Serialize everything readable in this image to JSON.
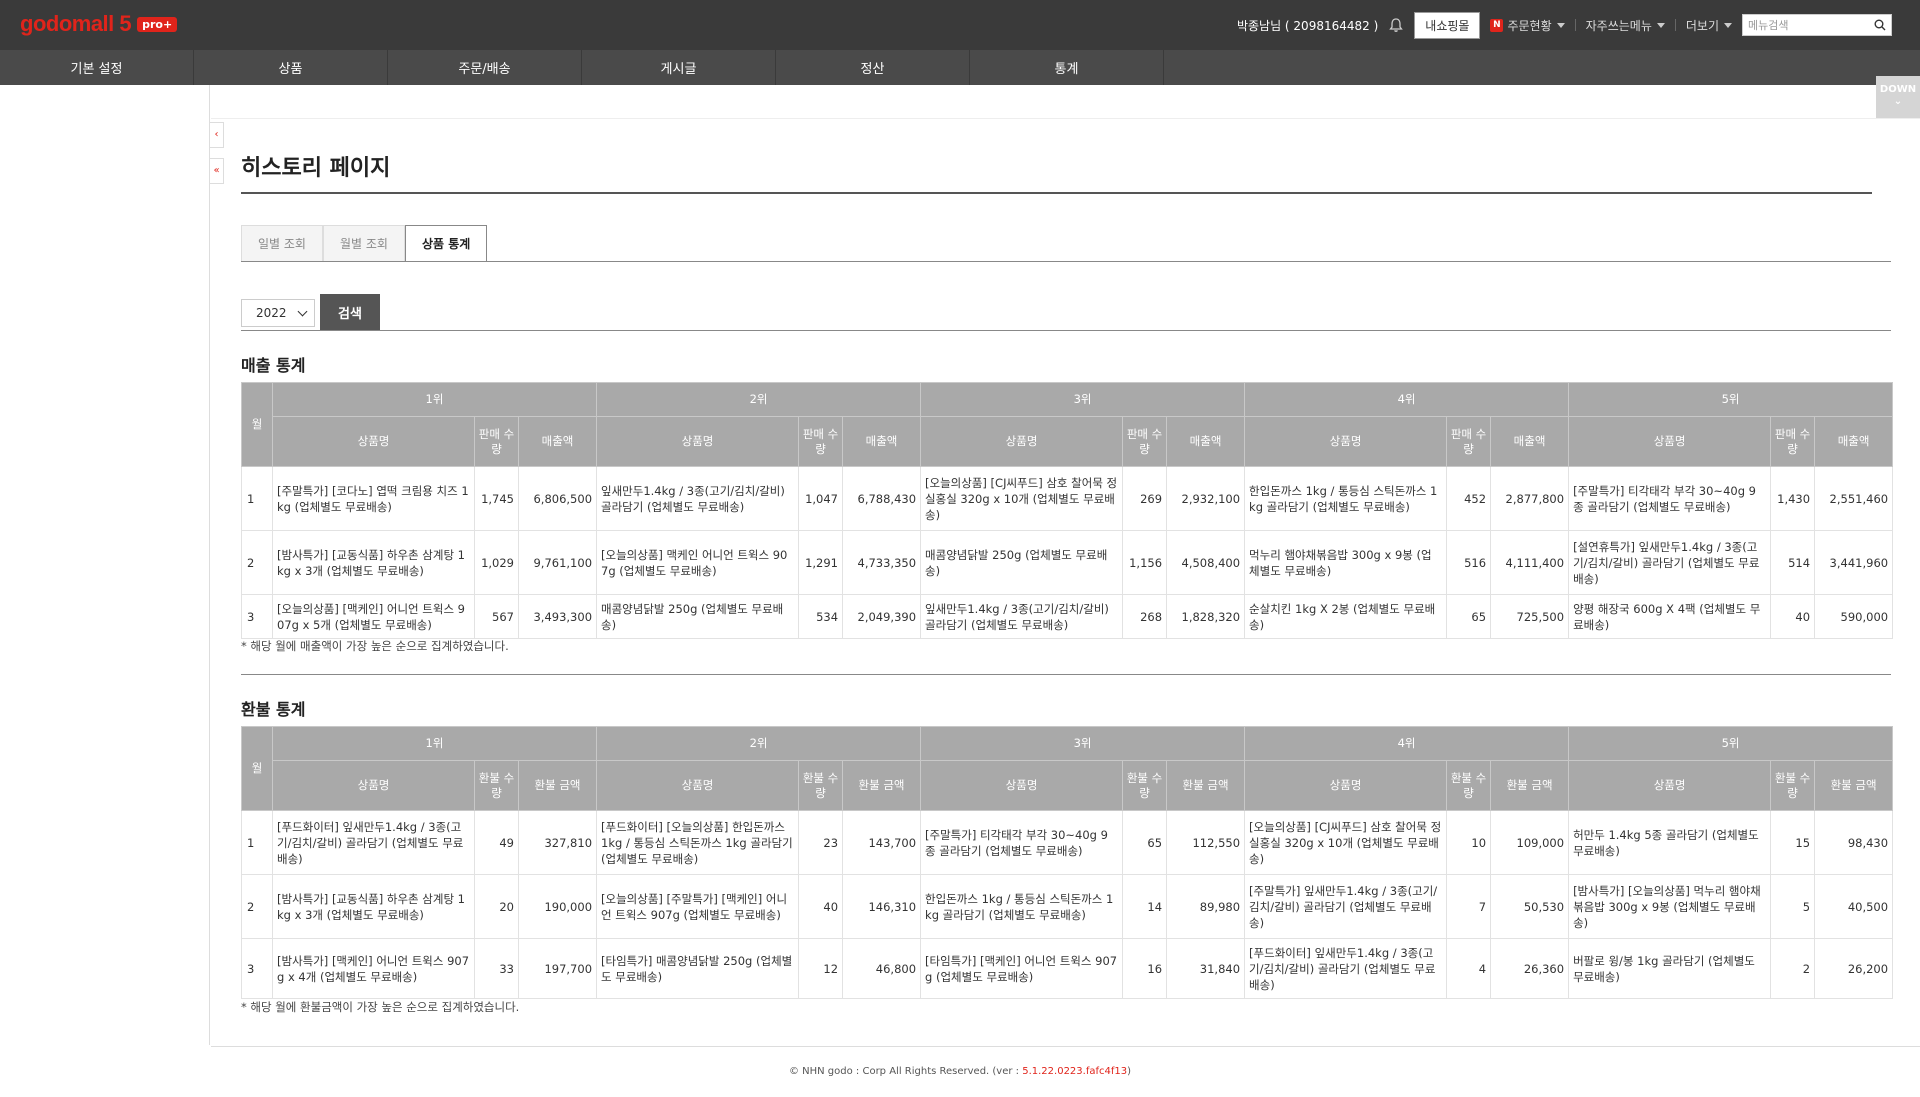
{
  "header": {
    "logo": "godomall 5",
    "logo_badge": "pro+",
    "user": "박종남님 ( 2098164482 )",
    "my_shop": "내쇼핑몰",
    "order_status": "주문현황",
    "favorites": "자주쓰는메뉴",
    "more": "더보기",
    "menu_search_placeholder": "메뉴검색"
  },
  "nav": [
    "기본 설정",
    "상품",
    "주문/배송",
    "게시글",
    "정산",
    "통계"
  ],
  "down_label": "DOWN",
  "page_title": "히스토리 페이지",
  "tabs": [
    "일별 조회",
    "월별 조회",
    "상품 통계"
  ],
  "year": "2022",
  "search_label": "검색",
  "sales": {
    "title": "매출 통계",
    "month_col": "월",
    "ranks": [
      "1위",
      "2위",
      "3위",
      "4위",
      "5위"
    ],
    "col_name": "상품명",
    "col_qty": "판매 수량",
    "col_amt": "매출액",
    "rows": [
      {
        "month": "1",
        "items": [
          {
            "name": "[주말특가] [코다노] 엽떡 크림용 치즈 1kg (업체별도 무료배송)",
            "qty": "1,745",
            "amt": "6,806,500"
          },
          {
            "name": "잎새만두1.4kg / 3종(고기/김치/갈비) 골라담기 (업체별도 무료배송)",
            "qty": "1,047",
            "amt": "6,788,430"
          },
          {
            "name": "[오늘의상품] [CJ씨푸드] 삼호 찰어묵 정실홍실 320g x 10개 (업체별도 무료배송)",
            "qty": "269",
            "amt": "2,932,100"
          },
          {
            "name": "한입돈까스 1kg / 통등심 스틱돈까스 1kg 골라담기 (업체별도 무료배송)",
            "qty": "452",
            "amt": "2,877,800"
          },
          {
            "name": "[주말특가] 티각태각 부각 30~40g 9종 골라담기 (업체별도 무료배송)",
            "qty": "1,430",
            "amt": "2,551,460"
          }
        ]
      },
      {
        "month": "2",
        "items": [
          {
            "name": "[밤사특가] [교동식품] 하우촌 삼계탕 1kg x 3개 (업체별도 무료배송)",
            "qty": "1,029",
            "amt": "9,761,100"
          },
          {
            "name": "[오늘의상품] 맥케인 어니언 트윅스 907g (업체별도 무료배송)",
            "qty": "1,291",
            "amt": "4,733,350"
          },
          {
            "name": "매콤양념닭발 250g (업체별도 무료배송)",
            "qty": "1,156",
            "amt": "4,508,400"
          },
          {
            "name": "먹누리 햄야채볶음밥 300g x 9봉 (업체별도 무료배송)",
            "qty": "516",
            "amt": "4,111,400"
          },
          {
            "name": "[설연휴특가] 잎새만두1.4kg / 3종(고기/김치/갈비) 골라담기 (업체별도 무료배송)",
            "qty": "514",
            "amt": "3,441,960"
          }
        ]
      },
      {
        "month": "3",
        "items": [
          {
            "name": "[오늘의상품] [맥케인] 어니언 트윅스 907g x 5개 (업체별도 무료배송)",
            "qty": "567",
            "amt": "3,493,300"
          },
          {
            "name": "매콤양념닭발 250g (업체별도 무료배송)",
            "qty": "534",
            "amt": "2,049,390"
          },
          {
            "name": "잎새만두1.4kg / 3종(고기/김치/갈비) 골라담기 (업체별도 무료배송)",
            "qty": "268",
            "amt": "1,828,320"
          },
          {
            "name": "순살치킨 1kg X 2봉 (업체별도 무료배송)",
            "qty": "65",
            "amt": "725,500"
          },
          {
            "name": "양평 해장국 600g X 4팩 (업체별도 무료배송)",
            "qty": "40",
            "amt": "590,000"
          }
        ]
      }
    ],
    "note": "* 해당 월에 매출액이 가장 높은 순으로 집계하였습니다."
  },
  "refund": {
    "title": "환불 통계",
    "month_col": "월",
    "ranks": [
      "1위",
      "2위",
      "3위",
      "4위",
      "5위"
    ],
    "col_name": "상품명",
    "col_qty": "환불 수량",
    "col_amt": "환불 금액",
    "rows": [
      {
        "month": "1",
        "items": [
          {
            "name": "[푸드화이터] 잎새만두1.4kg / 3종(고기/김치/갈비) 골라담기 (업체별도 무료배송)",
            "qty": "49",
            "amt": "327,810"
          },
          {
            "name": "[푸드화이터] [오늘의상품] 한입돈까스 1kg / 통등심 스틱돈까스 1kg 골라담기 (업체별도 무료배송)",
            "qty": "23",
            "amt": "143,700"
          },
          {
            "name": "[주말특가] 티각태각 부각 30~40g 9종 골라담기 (업체별도 무료배송)",
            "qty": "65",
            "amt": "112,550"
          },
          {
            "name": "[오늘의상품] [CJ씨푸드] 삼호 찰어묵 정실홍실 320g x 10개 (업체별도 무료배송)",
            "qty": "10",
            "amt": "109,000"
          },
          {
            "name": "허만두 1.4kg 5종 골라담기 (업체별도 무료배송)",
            "qty": "15",
            "amt": "98,430"
          }
        ]
      },
      {
        "month": "2",
        "items": [
          {
            "name": "[밤사특가] [교동식품] 하우촌 삼계탕 1kg x 3개 (업체별도 무료배송)",
            "qty": "20",
            "amt": "190,000"
          },
          {
            "name": "[오늘의상품] [주말특가] [맥케인] 어니언 트윅스 907g (업체별도 무료배송)",
            "qty": "40",
            "amt": "146,310"
          },
          {
            "name": "한입돈까스 1kg / 통등심 스틱돈까스 1kg 골라담기 (업체별도 무료배송)",
            "qty": "14",
            "amt": "89,980"
          },
          {
            "name": "[주말특가] 잎새만두1.4kg / 3종(고기/김치/갈비) 골라담기 (업체별도 무료배송)",
            "qty": "7",
            "amt": "50,530"
          },
          {
            "name": "[밤사특가] [오늘의상품] 먹누리 햄야채볶음밥 300g x 9봉 (업체별도 무료배송)",
            "qty": "5",
            "amt": "40,500"
          }
        ]
      },
      {
        "month": "3",
        "items": [
          {
            "name": "[밤사특가] [맥케인] 어니언 트윅스 907g x 4개 (업체별도 무료배송)",
            "qty": "33",
            "amt": "197,700"
          },
          {
            "name": "[타임특가] 매콤양념닭발 250g (업체별도 무료배송)",
            "qty": "12",
            "amt": "46,800"
          },
          {
            "name": "[타임특가] [맥케인] 어니언 트윅스 907g (업체별도 무료배송)",
            "qty": "16",
            "amt": "31,840"
          },
          {
            "name": "[푸드화이터] 잎새만두1.4kg / 3종(고기/김치/갈비) 골라담기 (업체별도 무료배송)",
            "qty": "4",
            "amt": "26,360"
          },
          {
            "name": "버팔로 윙/봉 1kg 골라담기 (업체별도 무료배송)",
            "qty": "2",
            "amt": "26,200"
          }
        ]
      }
    ],
    "note": "* 해당 월에 환불금액이 가장 높은 순으로 집계하였습니다."
  },
  "footer": {
    "copyright": "© NHN godo : Corp All Rights Reserved. (ver : ",
    "version": "5.1.22.0223.fafc4f13",
    "close": ")"
  }
}
